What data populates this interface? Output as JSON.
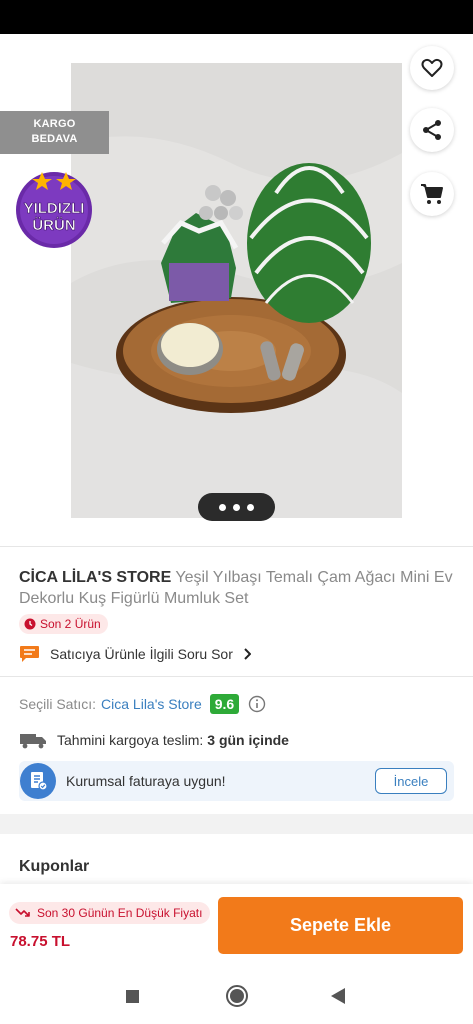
{
  "colors": {
    "accent": "#f27a1a",
    "price": "#c8102e",
    "link": "#3a7fbf",
    "rating": "#2eaa38"
  },
  "hero": {
    "badges": {
      "cargo_line1": "KARGO",
      "cargo_line2": "BEDAVA",
      "star_line1": "YILDIZLI",
      "star_line2": "ÜRÜN"
    },
    "icons": {
      "back": "arrow-left-icon",
      "favorite": "heart-icon",
      "share": "share-icon",
      "cart": "cart-icon"
    },
    "carousel_dots": 3
  },
  "product": {
    "store": "CİCA LİLA'S STORE",
    "name": "Yeşil Yılbaşı Temalı Çam Ağacı Mini Ev Dekorlu Kuş Figürlü Mumluk Set",
    "stock_text": "Son 2 Ürün",
    "ask_text": "Satıcıya Ürünle İlgili Soru Sor"
  },
  "seller": {
    "label": "Seçili Satıcı:",
    "name": "Cica Lila's Store",
    "rating": "9.6"
  },
  "shipping": {
    "label": "Tahmini kargoya teslim:",
    "value": "3 gün içinde"
  },
  "invoice": {
    "text": "Kurumsal faturaya uygun!",
    "button": "İncele"
  },
  "coupons": {
    "title": "Kuponlar"
  },
  "bottom_bar": {
    "lowest_price_text": "Son 30 Günün En Düşük Fiyatı",
    "price": "78.75 TL",
    "add_to_cart": "Sepete Ekle"
  }
}
